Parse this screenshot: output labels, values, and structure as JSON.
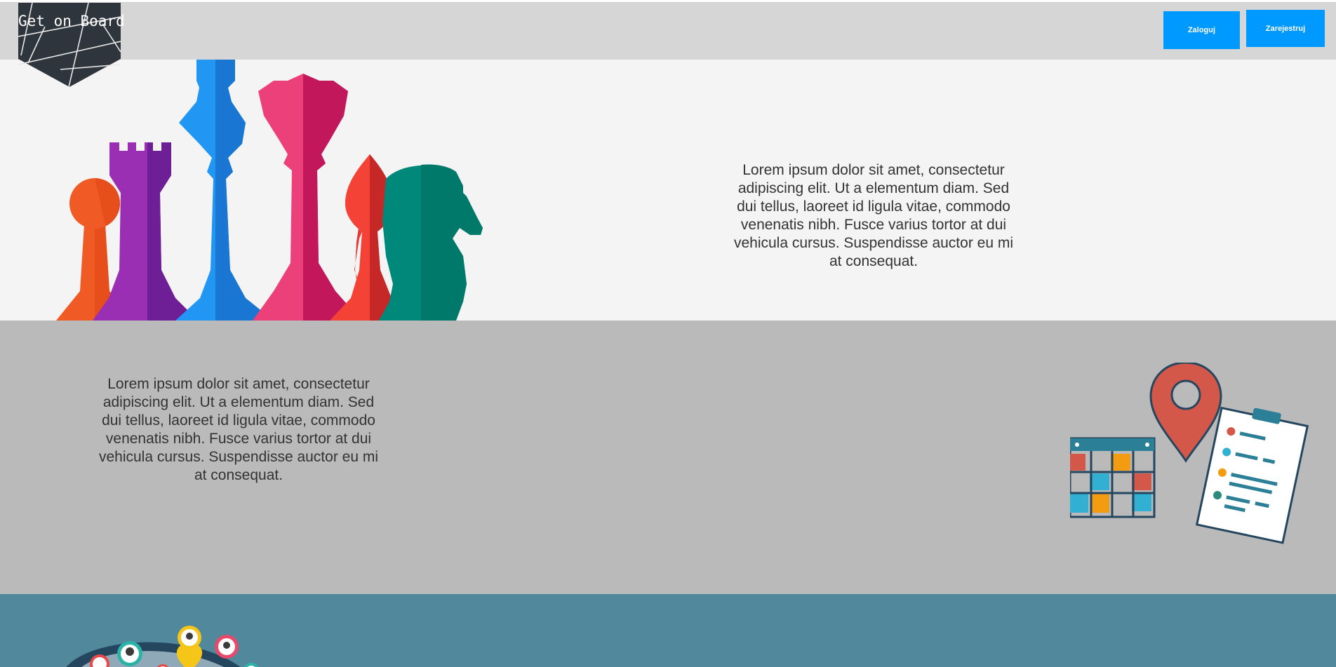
{
  "header": {
    "logo_text": "Get on Board",
    "login_label": "Zaloguj",
    "register_label": "Zarejestruj"
  },
  "section1": {
    "text": "Lorem ipsum dolor sit amet, consectetur adipiscing elit. Ut a elementum diam. Sed dui tellus, laoreet id ligula vitae, commodo venenatis nibh. Fusce varius tortor at dui vehicula cursus. Suspendisse auctor eu mi at consequat.",
    "illustration": "chess-pieces-illustration"
  },
  "section2": {
    "text": "Lorem ipsum dolor sit amet, consectetur adipiscing elit. Ut a elementum diam. Sed dui tellus, laoreet id ligula vitae, commodo venenatis nibh. Fusce varius tortor at dui vehicula cursus. Suspendisse auctor eu mi at consequat.",
    "illustration": "planner-calendar-map-pin-illustration"
  },
  "section3": {
    "illustration": "globe-people-pins-illustration"
  },
  "colors": {
    "header_bg": "#d6d6d6",
    "button_bg": "#0099ff",
    "section1_bg": "#f4f4f4",
    "section2_bg": "#bababa",
    "section3_bg": "#51889c",
    "logo_bg": "#2f353c"
  }
}
